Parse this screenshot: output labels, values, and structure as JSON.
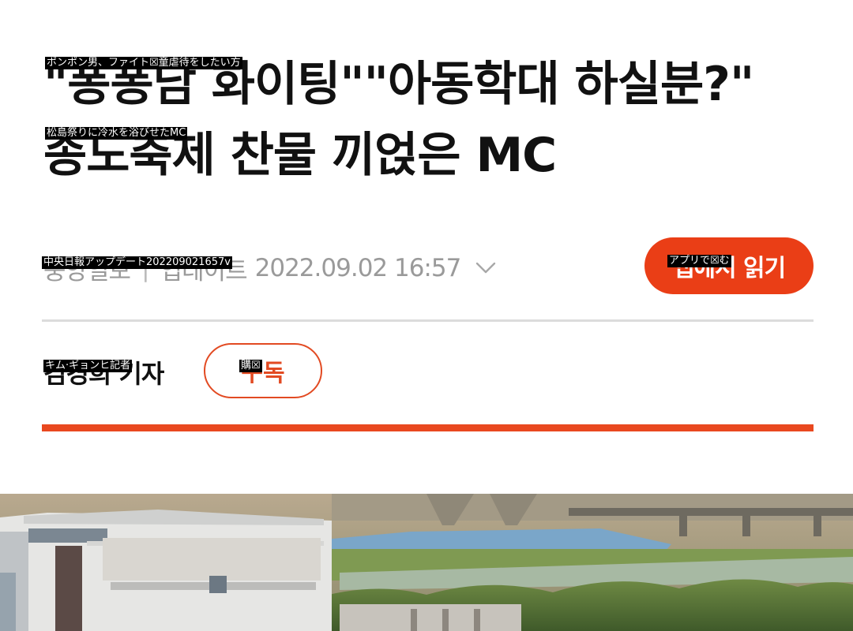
{
  "article": {
    "headline_line1": "\"퐁퐁남 화이팅\"\"아동학대 하실분?\"",
    "headline_line2": "송도축제 찬물 끼얹은 MC",
    "source": "중앙일보",
    "separator": "|",
    "updated_label": "업데이트",
    "updated_time": "2022.09.02 16:57",
    "app_button": "앱에서 읽기",
    "reporter": "김경희 기자",
    "subscribe_button": "구독"
  },
  "overlays": {
    "headline_line1": "ポンポン男、ファイト☒童虐待をしたい方",
    "headline_line2": "松島祭りに冷水を浴びせたMC",
    "meta": "中央日報アップデート202209021657v",
    "app_button": "アプリで☒む",
    "reporter": "キム·ギョンヒ記者",
    "subscribe": "購☒"
  },
  "icons": {
    "meta_toggle": "chevron-down-icon"
  },
  "colors": {
    "accent": "#ea3e16",
    "meta_text": "#9a9a9a",
    "divider": "#dcdcdc"
  }
}
